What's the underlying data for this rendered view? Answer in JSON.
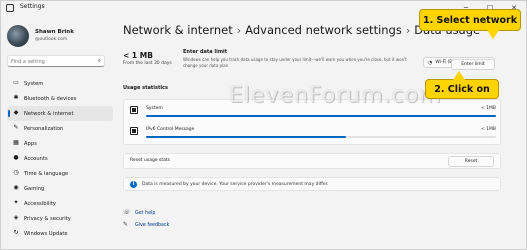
{
  "window": {
    "title": "Settings",
    "minimize": "─",
    "maximize": "☐",
    "close": "✕"
  },
  "profile": {
    "name": "Shawn Brink",
    "email": "@outlook.com"
  },
  "search": {
    "placeholder": "Find a setting",
    "icon": "search-icon"
  },
  "sidebar": {
    "items": [
      {
        "label": "System",
        "icon": "display-icon",
        "glyph": "▭",
        "active": false
      },
      {
        "label": "Bluetooth & devices",
        "icon": "bluetooth-icon",
        "glyph": "✱",
        "active": false
      },
      {
        "label": "Network & internet",
        "icon": "wifi-icon",
        "glyph": "◆",
        "active": true
      },
      {
        "label": "Personalization",
        "icon": "brush-icon",
        "glyph": "✎",
        "active": false
      },
      {
        "label": "Apps",
        "icon": "apps-icon",
        "glyph": "▦",
        "active": false
      },
      {
        "label": "Accounts",
        "icon": "person-icon",
        "glyph": "●",
        "active": false
      },
      {
        "label": "Time & language",
        "icon": "clock-icon",
        "glyph": "◷",
        "active": false
      },
      {
        "label": "Gaming",
        "icon": "gamepad-icon",
        "glyph": "◉",
        "active": false
      },
      {
        "label": "Accessibility",
        "icon": "accessibility-icon",
        "glyph": "✦",
        "active": false
      },
      {
        "label": "Privacy & security",
        "icon": "shield-icon",
        "glyph": "◈",
        "active": false
      },
      {
        "label": "Windows Update",
        "icon": "update-icon",
        "glyph": "↻",
        "active": false
      }
    ]
  },
  "breadcrumb": {
    "items": [
      "Network & internet",
      "Advanced network settings",
      "Data usage"
    ],
    "separator": "›"
  },
  "overview": {
    "usage_value": "< 1 MB",
    "usage_sub": "From the last 30 days",
    "limit_title": "Enter data limit",
    "limit_desc": "Windows can help you track data usage to stay under your limit—we'll warn you when you're close, but it won't change your data plan",
    "network_select": "Wi-Fi (Brink-Router2)",
    "enter_limit_button": "Enter limit"
  },
  "usage_statistics": {
    "title": "Usage statistics",
    "apps": [
      {
        "name": "System",
        "value": "< 1MB",
        "fill": 1.0
      },
      {
        "name": "IPv6 Control Message",
        "value": "< 1MB",
        "fill": 0.57
      }
    ]
  },
  "reset": {
    "label": "Reset usage stats",
    "button": "Reset"
  },
  "info": {
    "text": "Data is measured by your device. Your service provider's measurement may differ."
  },
  "links": [
    {
      "label": "Get help",
      "icon": "help-icon",
      "glyph": "☏"
    },
    {
      "label": "Give feedback",
      "icon": "feedback-icon",
      "glyph": "✎"
    }
  ],
  "watermark": "ElevenForum.com",
  "callouts": {
    "step1": "1. Select network",
    "step2": "2. Click on"
  },
  "colors": {
    "accent": "#0067c0",
    "callout": "#ffd400"
  }
}
